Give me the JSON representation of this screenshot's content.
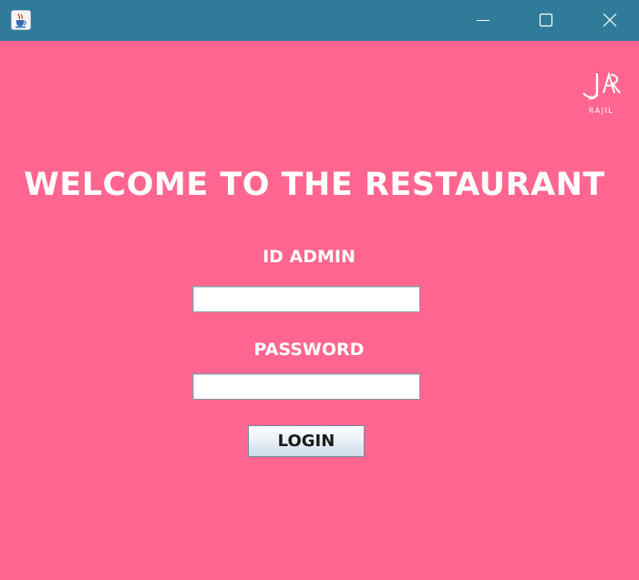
{
  "window": {
    "icon": "java-cup-icon",
    "controls": {
      "minimize": "minimize-icon",
      "maximize": "maximize-icon",
      "close": "close-icon"
    }
  },
  "logo": {
    "text": "RAJIL"
  },
  "main": {
    "title": "WELCOME TO THE RESTAURANT",
    "id_label": "ID ADMIN",
    "id_value": "",
    "password_label": "PASSWORD",
    "password_value": "",
    "login_label": "LOGIN"
  },
  "colors": {
    "background": "#ff668f",
    "titlebar": "#2e7c99",
    "text": "#ffffff"
  }
}
